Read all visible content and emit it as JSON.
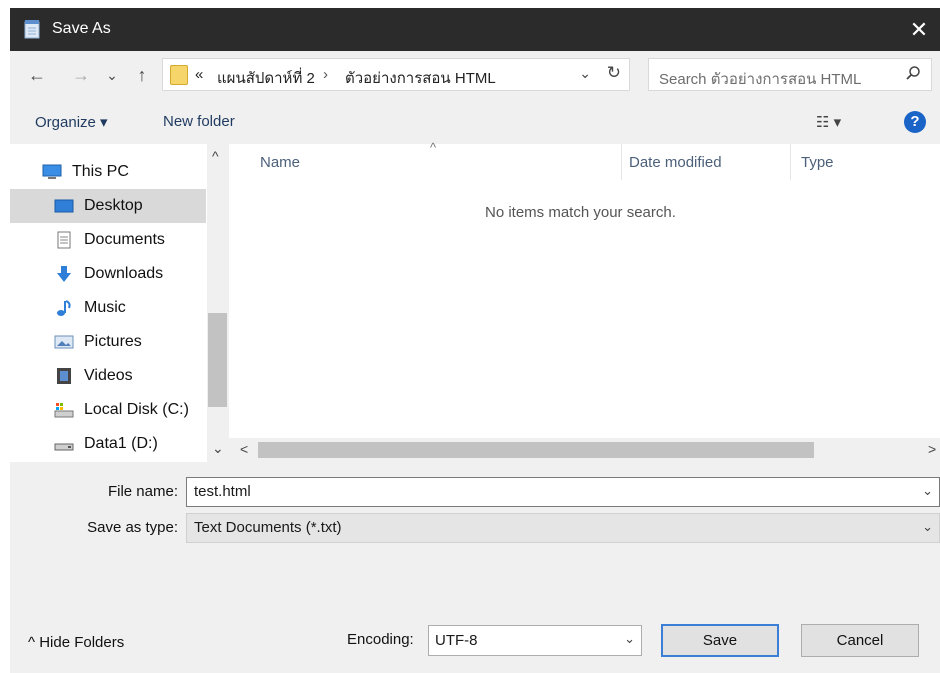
{
  "window": {
    "title": "Save As",
    "close_glyph": "✕"
  },
  "nav": {
    "back_glyph": "←",
    "forward_glyph": "→",
    "recent_glyph": "⌄",
    "up_glyph": "↑",
    "breadcrumb": {
      "overflow": "«",
      "sep": "›",
      "parent": "แผนสัปดาห์ที่ 2",
      "current": "ตัวอย่างการสอน HTML"
    },
    "dropdown_glyph": "⌄",
    "refresh_glyph": "↻",
    "search_placeholder": "Search ตัวอย่างการสอน HTML"
  },
  "toolbar": {
    "organize": "Organize ▾",
    "new_folder": "New folder",
    "view_glyph": "☷ ▾",
    "help": "?"
  },
  "sidebar": {
    "items": [
      {
        "label": "This PC",
        "icon": "computer-icon"
      },
      {
        "label": "Desktop",
        "icon": "desktop-icon",
        "selected": true
      },
      {
        "label": "Documents",
        "icon": "documents-icon"
      },
      {
        "label": "Downloads",
        "icon": "downloads-icon"
      },
      {
        "label": "Music",
        "icon": "music-icon"
      },
      {
        "label": "Pictures",
        "icon": "pictures-icon"
      },
      {
        "label": "Videos",
        "icon": "videos-icon"
      },
      {
        "label": "Local Disk (C:)",
        "icon": "local-disk-icon"
      },
      {
        "label": "Data1 (D:)",
        "icon": "drive-icon"
      }
    ],
    "scroll_up": "^",
    "scroll_down": "⌄"
  },
  "filelist": {
    "columns": [
      "Name",
      "Date modified",
      "Type"
    ],
    "sort_glyph": "^",
    "empty_message": "No items match your search.",
    "scroll_left": "<",
    "scroll_right": ">"
  },
  "form": {
    "file_name_label": "File name:",
    "file_name_value": "test.html",
    "save_type_label": "Save as type:",
    "save_type_value": "Text Documents (*.txt)",
    "chevron": "⌄"
  },
  "footer": {
    "hide_folders": "^  Hide Folders",
    "encoding_label": "Encoding:",
    "encoding_value": "UTF-8",
    "save": "Save",
    "cancel": "Cancel"
  },
  "colors": {
    "titlebar": "#2b2b2b",
    "dialog": "#f0f0f0",
    "selected": "#d9d9d9",
    "accent": "#3a7fd5",
    "help": "#1a64c8"
  }
}
